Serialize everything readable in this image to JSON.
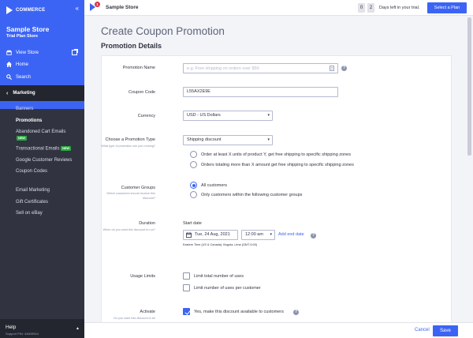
{
  "sidebar": {
    "logo_text": "COMMERCE",
    "store_name": "Sample Store",
    "store_plan": "Trial Plan Store",
    "links": [
      {
        "label": "View Store",
        "icon": "store-icon"
      },
      {
        "label": "Home",
        "icon": "home-icon"
      },
      {
        "label": "Search",
        "icon": "search-icon"
      }
    ],
    "section": "Marketing",
    "menu": [
      {
        "label": "Banners",
        "active": false
      },
      {
        "label": "Promotions",
        "active": true
      },
      {
        "label": "Abandoned Cart Emails",
        "badge": "NEW"
      },
      {
        "label": "Transactional Emails",
        "badge": "NEW"
      },
      {
        "label": "Google Customer Reviews"
      },
      {
        "label": "Coupon Codes"
      },
      {
        "label": "Email Marketing"
      },
      {
        "label": "Gift Certificates"
      },
      {
        "label": "Sell on eBay"
      }
    ],
    "help_label": "Help",
    "help_sub": "Support PIN: 44609944"
  },
  "header": {
    "notification_count": "1",
    "store_name": "Sample Store",
    "trial_digits": [
      "0",
      "2"
    ],
    "trial_text": "Days left in your trial.",
    "select_plan": "Select a Plan"
  },
  "main": {
    "page_title": "Create Coupon Promotion",
    "section_title": "Promotion Details",
    "fields": {
      "promotion_name": {
        "label": "Promotion Name",
        "placeholder": "e.g. Free shipping on orders over $50"
      },
      "coupon_code": {
        "label": "Coupon Code",
        "value": "L55AX2E9E"
      },
      "currency": {
        "label": "Currency",
        "value": "USD - US Dollars"
      },
      "promotion_type": {
        "label": "Choose a Promotion Type",
        "hint": "What type of promotion are you running?",
        "value": "Shipping discount",
        "options": [
          "Order at least X units of product Y, get free shipping to specific shipping zones",
          "Orders totaling more than X amount get free shipping to specific shipping zones"
        ]
      },
      "customer_groups": {
        "label": "Customer Groups",
        "hint": "Which customers should receive this discount?",
        "options": [
          "All customers",
          "Only customers within the following customer groups"
        ]
      },
      "duration": {
        "label": "Duration",
        "hint": "When do you want this discount to run?",
        "start_label": "Start date",
        "date": "Tue, 24 Aug, 2021",
        "time": "12:00 am",
        "add_end": "Add end date",
        "timezone": "Eastern Time (US & Canada), Bogota, Lima (GMT-5:00)"
      },
      "usage_limits": {
        "label": "Usage Limits",
        "options": [
          "Limit total number of uses",
          "Limit number of uses per customer"
        ]
      },
      "activate": {
        "label": "Activate",
        "hint": "Do you want this discount to be",
        "option": "Yes, make this discount available to customers"
      }
    }
  },
  "footer": {
    "cancel": "Cancel",
    "save": "Save"
  },
  "colors": {
    "accent": "#3c64f4",
    "sidebar": "#313440",
    "badge_green": "#2aab3f",
    "notification_red": "#db3643"
  }
}
